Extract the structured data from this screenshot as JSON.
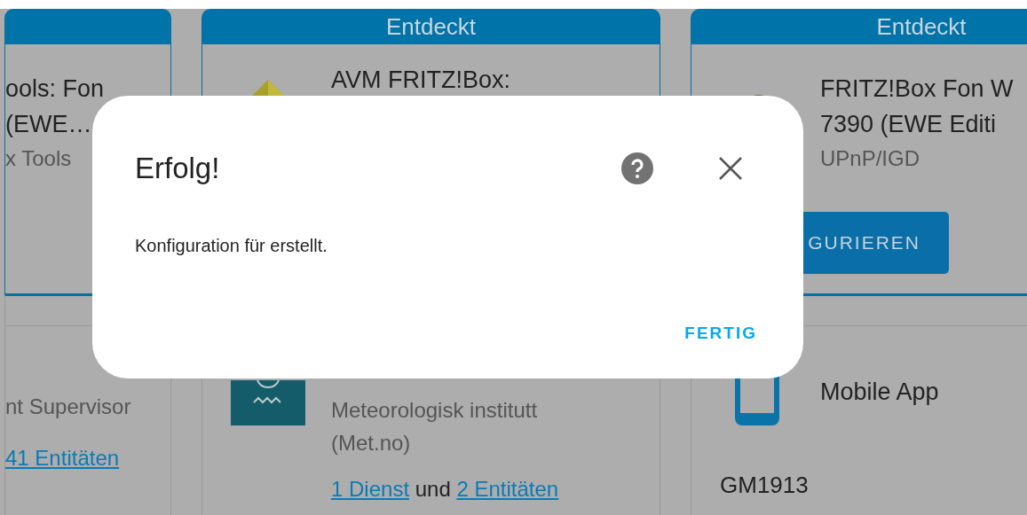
{
  "columns": [
    {
      "cards": [
        {
          "kind": "discovered",
          "title_lines": [
            "ools: Fon",
            "(EWE…"
          ],
          "subtitle_lines": [
            "x Tools"
          ]
        },
        {
          "kind": "configured",
          "subtitle_lines": [
            "nt Supervisor"
          ],
          "links": [
            {
              "kind": "link",
              "text": "41 Entitäten"
            }
          ]
        }
      ]
    },
    {
      "cards": [
        {
          "kind": "discovered",
          "header": "Entdeckt",
          "title_lines": [
            "AVM FRITZ!Box:"
          ]
        },
        {
          "kind": "configured",
          "subtitle_lines": [
            "Meteorologisk institutt",
            "(Met.no)"
          ],
          "links": [
            {
              "kind": "link",
              "text": "1 Dienst"
            },
            {
              "kind": "text",
              "text": "und"
            },
            {
              "kind": "link",
              "text": "2 Entitäten"
            }
          ]
        }
      ]
    },
    {
      "cards": [
        {
          "kind": "discovered",
          "header": "Entdeckt",
          "title_lines": [
            "FRITZ!Box Fon W",
            "7390 (EWE Editi"
          ],
          "subtitle_lines": [
            "UPnP/IGD"
          ],
          "button": "GURIEREN"
        },
        {
          "kind": "configured",
          "title_lines": [
            "Mobile App"
          ],
          "device": "GM1913"
        }
      ]
    }
  ],
  "dialog": {
    "title": "Erfolg!",
    "message": "Konfiguration für erstellt.",
    "action": "FERTIG"
  }
}
